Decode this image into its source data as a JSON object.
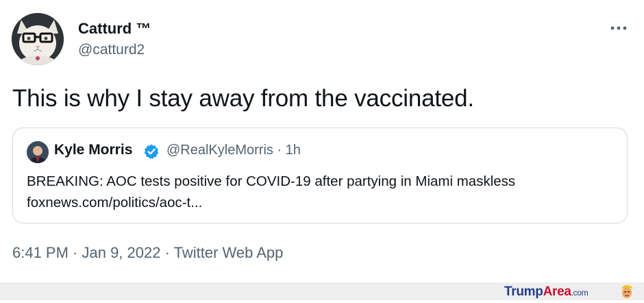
{
  "tweet": {
    "author": {
      "display_name": "Catturd ™",
      "handle": "@catturd2",
      "avatar_icon": "cat-with-glasses-avatar"
    },
    "more_icon": "more-horizontal-icon",
    "text": "This is why I stay away from the vaccinated.",
    "quote": {
      "display_name": "Kyle Morris",
      "verified_icon": "verified-badge-icon",
      "handle_time": "@RealKyleMorris · 1h",
      "text_line1": "BREAKING: AOC tests positive for COVID-19 after partying in Miami maskless",
      "text_line2": "foxnews.com/politics/aoc-t..."
    },
    "timestamp": "6:41 PM · Jan 9, 2022 · Twitter Web App"
  },
  "watermark": {
    "part1": "Trump",
    "part2": "Area",
    "part3": ".com",
    "logo_icon": "trump-face-logo"
  },
  "colors": {
    "text_primary": "#0f1419",
    "text_secondary": "#536471",
    "border": "#cfd9de",
    "verified": "#1d9bf0"
  }
}
